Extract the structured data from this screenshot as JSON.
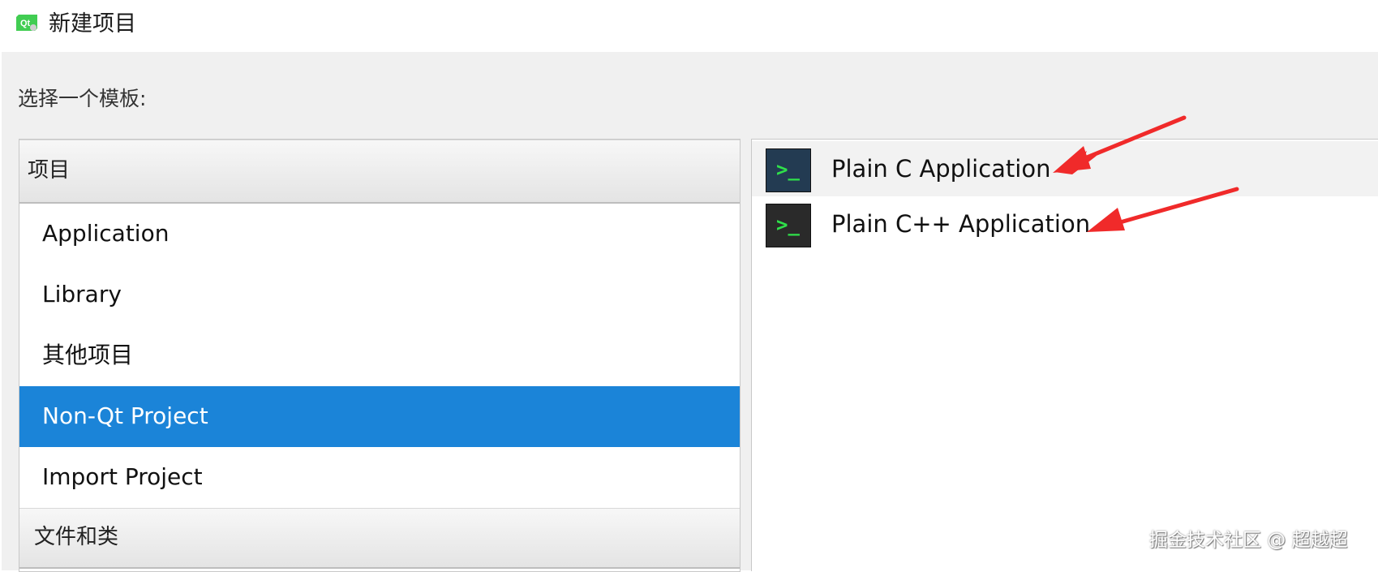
{
  "window": {
    "title": "新建项目",
    "icon": "qt-logo-icon"
  },
  "prompt": "选择一个模板:",
  "categories": {
    "group_projects": "项目",
    "items": [
      {
        "label": "Application",
        "selected": false
      },
      {
        "label": "Library",
        "selected": false
      },
      {
        "label": "其他项目",
        "selected": false
      },
      {
        "label": "Non-Qt Project",
        "selected": true
      },
      {
        "label": "Import Project",
        "selected": false
      }
    ],
    "group_files": "文件和类"
  },
  "templates": [
    {
      "label": "Plain C Application",
      "icon": "terminal-icon",
      "selected": true
    },
    {
      "label": "Plain C++ Application",
      "icon": "terminal-icon",
      "selected": false
    }
  ],
  "annotation_color": "#f02a2a",
  "selection_color": "#1b84d8",
  "watermark": "掘金技术社区 @ 超越超"
}
